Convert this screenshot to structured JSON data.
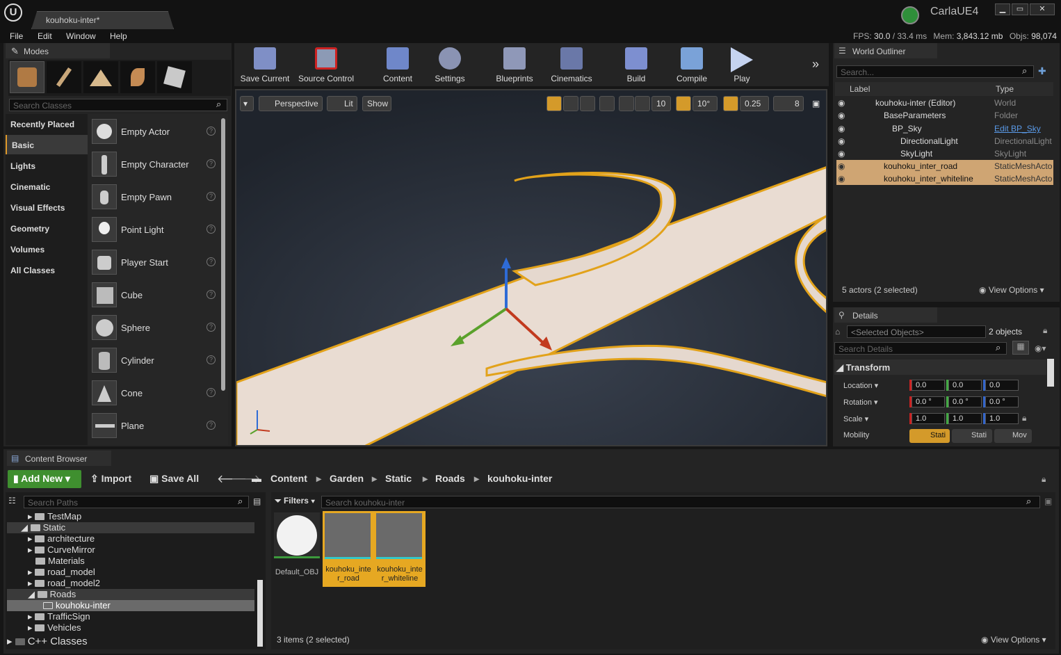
{
  "app": {
    "doc_tab": "kouhoku-inter*",
    "project": "CarlaUE4"
  },
  "menu": [
    "File",
    "Edit",
    "Window",
    "Help"
  ],
  "stats": {
    "fps_label": "FPS:",
    "fps": "30.0",
    "ms": "/ 33.4 ms",
    "mem_label": "Mem:",
    "mem": "3,843.12 mb",
    "objs_label": "Objs:",
    "objs": "98,074"
  },
  "modes": {
    "tab": "Modes",
    "search_placeholder": "Search Classes",
    "categories": [
      "Recently Placed",
      "Basic",
      "Lights",
      "Cinematic",
      "Visual Effects",
      "Geometry",
      "Volumes",
      "All Classes"
    ],
    "items": [
      "Empty Actor",
      "Empty Character",
      "Empty Pawn",
      "Point Light",
      "Player Start",
      "Cube",
      "Sphere",
      "Cylinder",
      "Cone",
      "Plane"
    ]
  },
  "toolbar": {
    "buttons": [
      "Save Current",
      "Source Control",
      "Content",
      "Settings",
      "Blueprints",
      "Cinematics",
      "Build",
      "Compile",
      "Play"
    ]
  },
  "viewport": {
    "perspective": "Perspective",
    "lit": "Lit",
    "show": "Show",
    "grid": "10",
    "rot": "10°",
    "scale": "0.25",
    "speed": "8"
  },
  "outliner": {
    "tab": "World Outliner",
    "search_placeholder": "Search...",
    "col_label": "Label",
    "col_type": "Type",
    "rows": [
      {
        "label": "kouhoku-inter (Editor)",
        "type": "World"
      },
      {
        "label": "BaseParameters",
        "type": "Folder"
      },
      {
        "label": "BP_Sky",
        "type": "Edit BP_Sky"
      },
      {
        "label": "DirectionalLight",
        "type": "DirectionalLight"
      },
      {
        "label": "SkyLight",
        "type": "SkyLight"
      },
      {
        "label": "kouhoku_inter_road",
        "type": "StaticMeshActor"
      },
      {
        "label": "kouhoku_inter_whiteline",
        "type": "StaticMeshActor"
      }
    ],
    "status": "5 actors (2 selected)",
    "view_options": "View Options"
  },
  "details": {
    "tab": "Details",
    "selected_placeholder": "<Selected Objects>",
    "count": "2 objects",
    "search_placeholder": "Search Details",
    "section": "Transform",
    "location_label": "Location",
    "location": [
      "0.0",
      "0.0",
      "0.0"
    ],
    "rotation_label": "Rotation",
    "rotation": [
      "0.0 °",
      "0.0 °",
      "0.0 °"
    ],
    "scale_label": "Scale",
    "scale": [
      "1.0",
      "1.0",
      "1.0"
    ],
    "mobility_label": "Mobility",
    "mobility": [
      "Stati",
      "Stati",
      "Mov"
    ]
  },
  "content": {
    "tab": "Content Browser",
    "add_new": "Add New",
    "import": "Import",
    "save_all": "Save All",
    "breadcrumb": [
      "Content",
      "Garden",
      "Static",
      "Roads",
      "kouhoku-inter"
    ],
    "paths_placeholder": "Search Paths",
    "filters": "Filters",
    "search_placeholder": "Search kouhoku-inter",
    "tree": [
      "TestMap",
      "Static",
      "architecture",
      "CurveMirror",
      "Materials",
      "road_model",
      "road_model2",
      "Roads",
      "kouhoku-inter",
      "TrafficSign",
      "Vehicles",
      "C++ Classes"
    ],
    "assets": [
      "Default_OBJ",
      "kouhoku_inter_road",
      "kouhoku_inter_whiteline"
    ],
    "status": "3 items (2 selected)",
    "view_options": "View Options"
  }
}
